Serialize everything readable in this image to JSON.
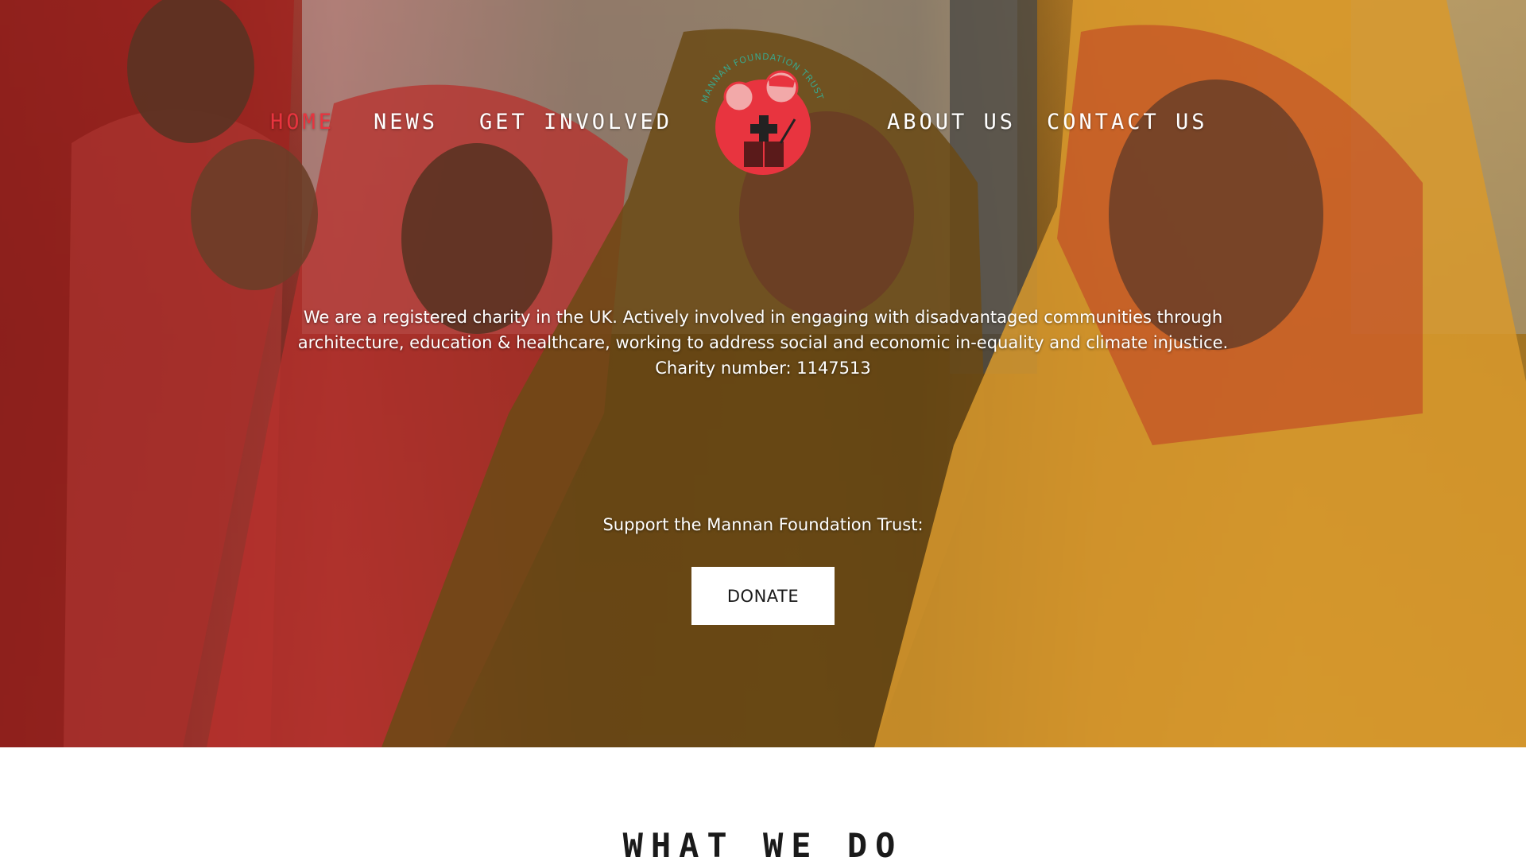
{
  "nav": {
    "items": [
      {
        "label": "HOME",
        "active": true
      },
      {
        "label": "NEWS",
        "active": false
      },
      {
        "label": "GET INVOLVED",
        "active": false
      },
      {
        "label": "ABOUT US",
        "active": false
      },
      {
        "label": "CONTACT US",
        "active": false
      }
    ]
  },
  "logo": {
    "arc_text": "MANNAN FOUNDATION TRUST",
    "colors": {
      "primary": "#e8343f",
      "accent": "#3aa58a"
    }
  },
  "hero": {
    "text_line1": "We are a registered charity in the UK. Actively involved in engaging with disadvantaged communities through",
    "text_line2": "architecture, education & healthcare, working to address social and economic in-equality and climate injustice.",
    "text_line3": "Charity number: 1147513",
    "support_text": "Support the Mannan Foundation Trust:",
    "donate_label": "DONATE"
  },
  "section": {
    "title": "WHAT WE DO"
  },
  "colors": {
    "active_nav": "#e8343f",
    "nav_text": "#ffffff",
    "button_bg": "#ffffff",
    "heading": "#1a1a1a"
  }
}
